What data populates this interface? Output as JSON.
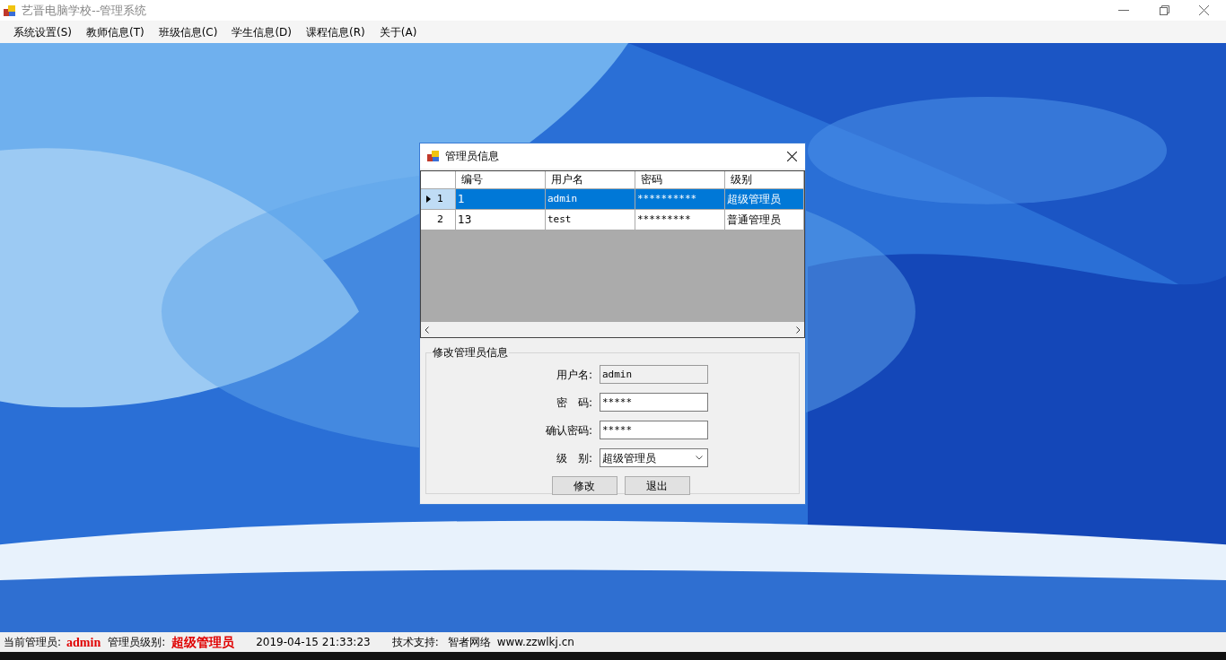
{
  "window": {
    "title": "艺晋电脑学校--管理系统"
  },
  "menu": [
    {
      "label": "系统设置(S)"
    },
    {
      "label": "教师信息(T)"
    },
    {
      "label": "班级信息(C)"
    },
    {
      "label": "学生信息(D)"
    },
    {
      "label": "课程信息(R)"
    },
    {
      "label": "关于(A)"
    }
  ],
  "dialog": {
    "title": "管理员信息",
    "table": {
      "columns": [
        "编号",
        "用户名",
        "密码",
        "级别"
      ],
      "rows": [
        {
          "row_number": "1",
          "selected": true,
          "cells": [
            "1",
            "admin",
            "**********",
            "超级管理员"
          ]
        },
        {
          "row_number": "2",
          "selected": false,
          "cells": [
            "13",
            "test",
            "*********",
            "普通管理员"
          ]
        }
      ]
    },
    "group": {
      "title": "修改管理员信息",
      "fields": [
        {
          "label": "用户名:",
          "kind": "text",
          "value": "admin",
          "disabled": true
        },
        {
          "label": "密　码:",
          "kind": "text",
          "value": "*****",
          "disabled": false
        },
        {
          "label": "确认密码:",
          "kind": "text",
          "value": "*****",
          "disabled": false
        },
        {
          "label": "级　别:",
          "kind": "combo",
          "value": "超级管理员",
          "disabled": false
        }
      ],
      "buttons": [
        "修改",
        "退出"
      ]
    }
  },
  "status_bar": [
    {
      "text": "当前管理员:",
      "kind": "label"
    },
    {
      "text": "admin",
      "kind": "value"
    },
    {
      "text": "管理员级别:",
      "kind": "label"
    },
    {
      "text": "超级管理员",
      "kind": "value"
    },
    {
      "text": "2019-04-15 21:33:23",
      "kind": "label"
    },
    {
      "text": "技术支持:",
      "kind": "label"
    },
    {
      "text": "智者网络",
      "kind": "label"
    },
    {
      "text": "www.zzwlkj.cn",
      "kind": "label"
    }
  ]
}
